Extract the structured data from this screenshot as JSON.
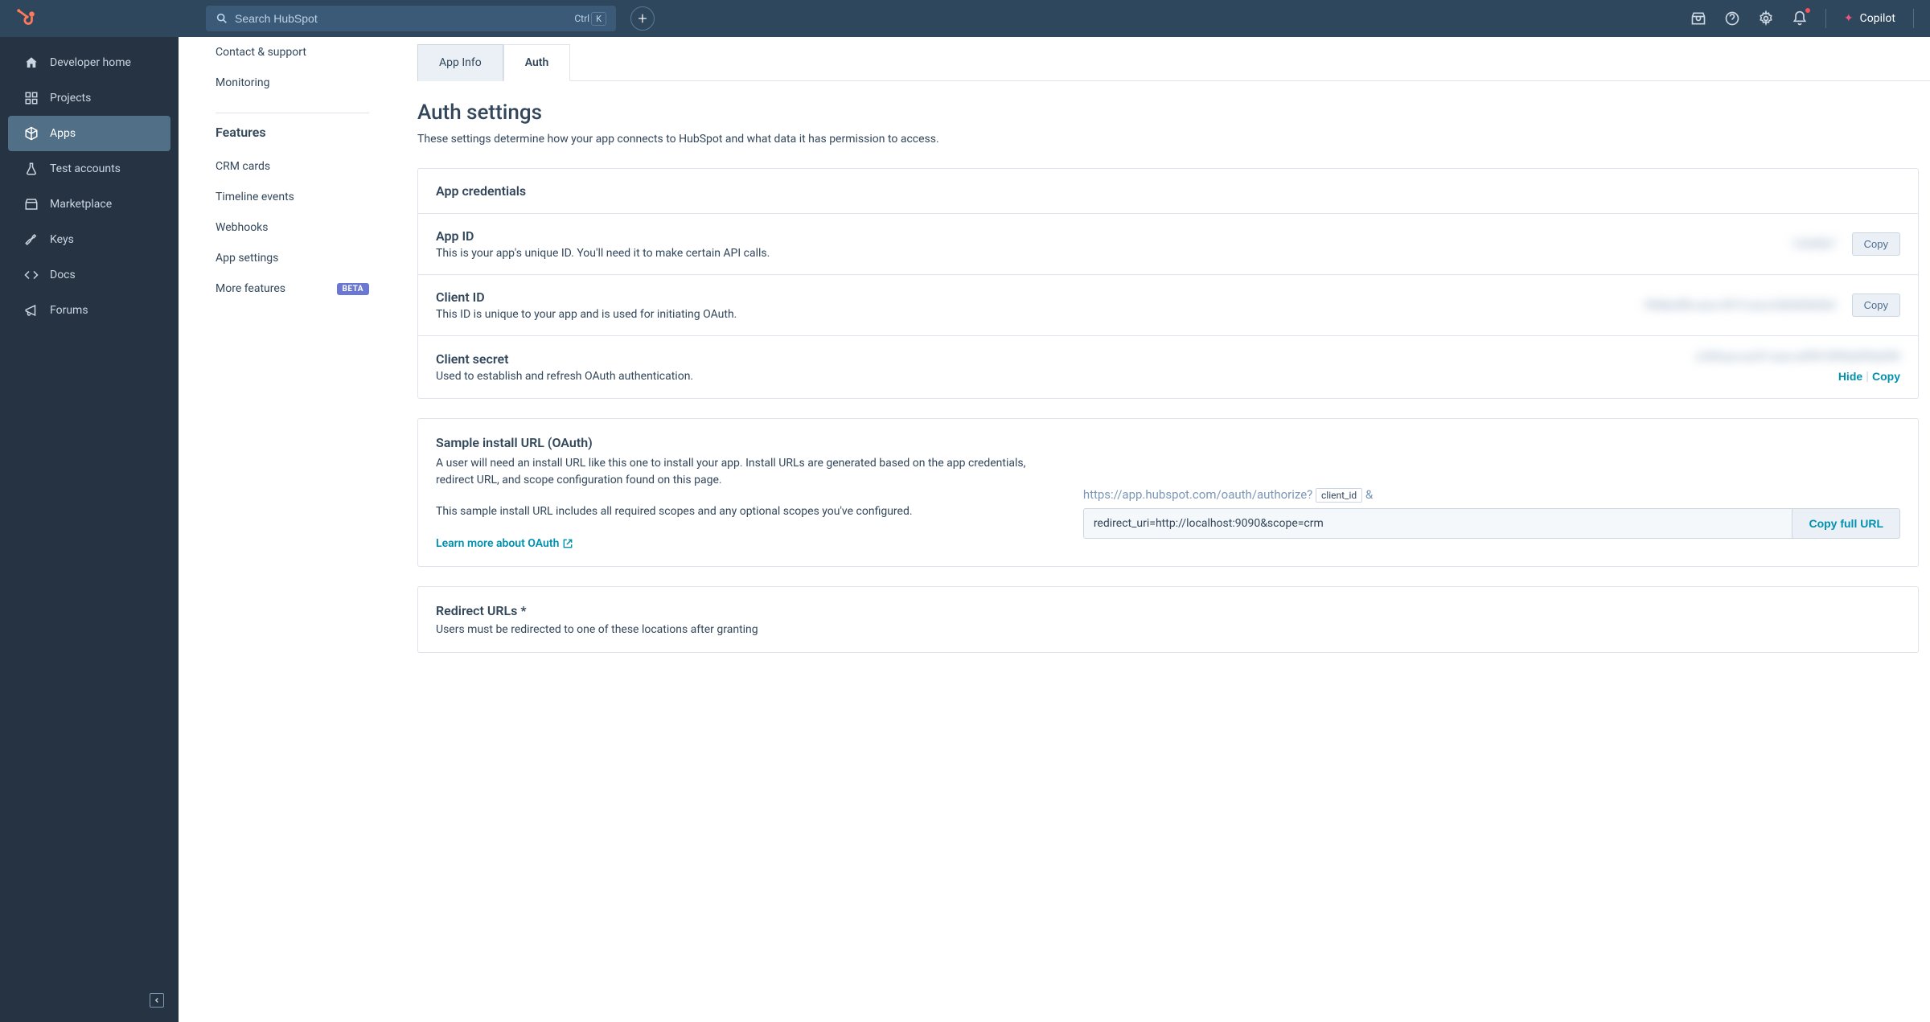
{
  "topbar": {
    "search_placeholder": "Search HubSpot",
    "kbd_ctrl": "Ctrl",
    "kbd_k": "K",
    "copilot_label": "Copilot"
  },
  "sidebar": {
    "items": [
      {
        "label": "Developer home"
      },
      {
        "label": "Projects"
      },
      {
        "label": "Apps"
      },
      {
        "label": "Test accounts"
      },
      {
        "label": "Marketplace"
      },
      {
        "label": "Keys"
      },
      {
        "label": "Docs"
      },
      {
        "label": "Forums"
      }
    ]
  },
  "inner": {
    "contact": "Contact & support",
    "monitoring": "Monitoring",
    "features_title": "Features",
    "crm_cards": "CRM cards",
    "timeline": "Timeline events",
    "webhooks": "Webhooks",
    "app_settings": "App settings",
    "more_features": "More features",
    "beta_label": "BETA"
  },
  "tabs": {
    "app_info": "App Info",
    "auth": "Auth"
  },
  "page": {
    "title": "Auth settings",
    "subtitle": "These settings determine how your app connects to HubSpot and what data it has permission to access."
  },
  "credentials": {
    "header": "App credentials",
    "app_id": {
      "title": "App ID",
      "desc": "This is your app's unique ID. You'll need it to make certain API calls.",
      "blur": "1234567",
      "copy": "Copy"
    },
    "client_id": {
      "title": "Client ID",
      "desc": "This ID is unique to your app and is used for initiating OAuth.",
      "blur": "99dba4fb-xxxx-491f-xxxx-b3b3b3b3b3",
      "copy": "Copy"
    },
    "client_secret": {
      "title": "Client secret",
      "desc": "Used to establish and refresh OAuth authentication.",
      "blur": "c24fxxxx-ac57-xxxx-a999-9999a999a999",
      "hide": "Hide",
      "copy": "Copy"
    }
  },
  "install": {
    "title": "Sample install URL (OAuth)",
    "desc1": "A user will need an install URL like this one to install your app. Install URLs are generated based on the app credentials, redirect URL, and scope configuration found on this page.",
    "desc2": "This sample install URL includes all required scopes and any optional scopes you've configured.",
    "learn": "Learn more about OAuth",
    "preview_url": "https://app.hubspot.com/oauth/authorize?",
    "chip": "client_id",
    "amp": "&",
    "input_value": "redirect_uri=http://localhost:9090&scope=crm",
    "copy_full": "Copy full URL"
  },
  "redirect": {
    "title": "Redirect URLs *",
    "desc": "Users must be redirected to one of these locations after granting"
  }
}
